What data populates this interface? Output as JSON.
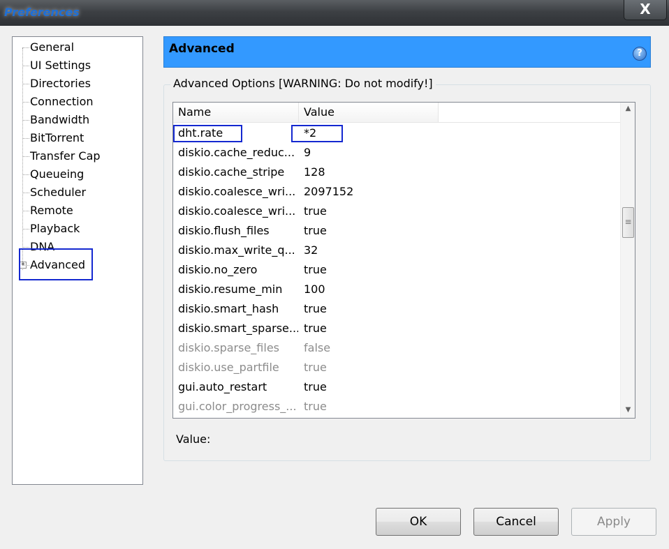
{
  "window": {
    "title": "Preferences",
    "close_label": "X"
  },
  "tree": {
    "items": [
      {
        "label": "General"
      },
      {
        "label": "UI Settings"
      },
      {
        "label": "Directories"
      },
      {
        "label": "Connection"
      },
      {
        "label": "Bandwidth"
      },
      {
        "label": "BitTorrent"
      },
      {
        "label": "Transfer Cap"
      },
      {
        "label": "Queueing"
      },
      {
        "label": "Scheduler"
      },
      {
        "label": "Remote"
      },
      {
        "label": "Playback"
      },
      {
        "label": "DNA"
      },
      {
        "label": "Advanced"
      }
    ],
    "expander": "+"
  },
  "header": {
    "title": "Advanced",
    "help_icon": "?"
  },
  "group": {
    "label": "Advanced Options [WARNING: Do not modify!]"
  },
  "table": {
    "columns": [
      "Name",
      "Value"
    ],
    "rows": [
      {
        "name": "dht.rate",
        "value": "*2"
      },
      {
        "name": "diskio.cache_reduc...",
        "value": "9"
      },
      {
        "name": "diskio.cache_stripe",
        "value": "128"
      },
      {
        "name": "diskio.coalesce_wri...",
        "value": "2097152"
      },
      {
        "name": "diskio.coalesce_wri...",
        "value": "true"
      },
      {
        "name": "diskio.flush_files",
        "value": "true"
      },
      {
        "name": "diskio.max_write_q...",
        "value": "32"
      },
      {
        "name": "diskio.no_zero",
        "value": "true"
      },
      {
        "name": "diskio.resume_min",
        "value": "100"
      },
      {
        "name": "diskio.smart_hash",
        "value": "true"
      },
      {
        "name": "diskio.smart_sparse...",
        "value": "true"
      },
      {
        "name": "diskio.sparse_files",
        "value": "false"
      },
      {
        "name": "diskio.use_partfile",
        "value": "true"
      },
      {
        "name": "gui.auto_restart",
        "value": "true"
      },
      {
        "name": "gui.color_progress_...",
        "value": "true"
      }
    ],
    "scroll_up": "▲",
    "scroll_down": "▼"
  },
  "value_label": "Value:",
  "buttons": {
    "ok": "OK",
    "cancel": "Cancel",
    "apply": "Apply"
  }
}
